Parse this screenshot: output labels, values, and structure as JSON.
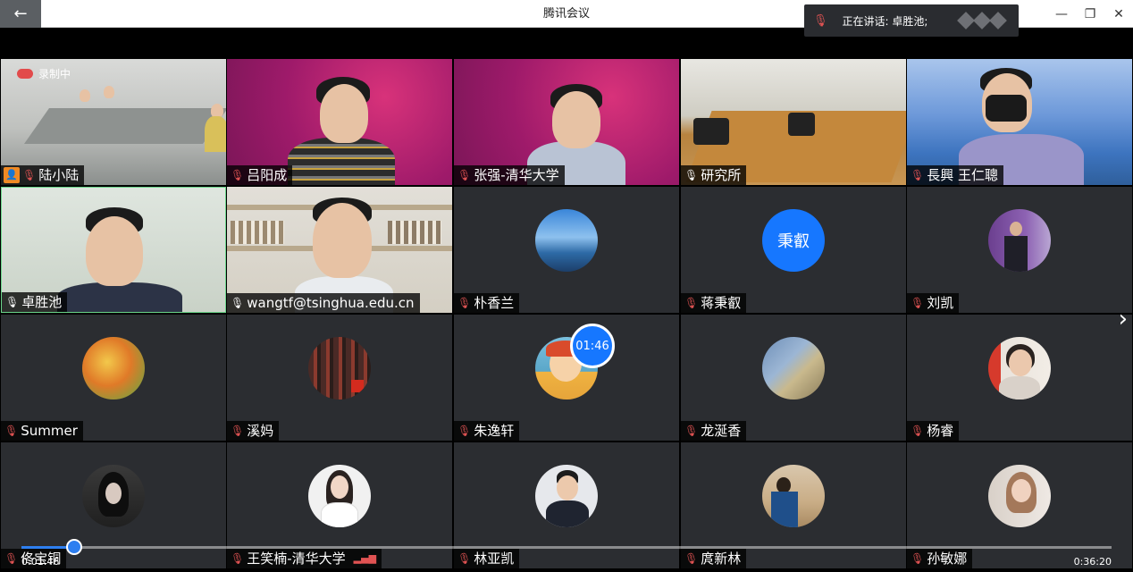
{
  "window": {
    "title": "腾讯会议",
    "back_glyph": "←",
    "minimize_glyph": "—",
    "restore_glyph": "❐",
    "close_glyph": "✕"
  },
  "speaking_banner": {
    "text": "正在讲话: 卓胜池;",
    "icon": "mic-muted-icon"
  },
  "recording": {
    "label": "录制中"
  },
  "participants": [
    {
      "name": "陆小陆",
      "mic": "muted",
      "scene": "meeting-room",
      "host": true
    },
    {
      "name": "吕阳成",
      "mic": "muted",
      "scene": "magenta"
    },
    {
      "name": "张强-清华大学",
      "mic": "muted",
      "scene": "magenta"
    },
    {
      "name": "研究所",
      "mic": "on",
      "scene": "office"
    },
    {
      "name": "長興 王仁聰",
      "mic": "muted",
      "scene": "blue-sky"
    },
    {
      "name": "卓胜池",
      "mic": "on",
      "scene": "green-wall"
    },
    {
      "name": "wangtf@tsinghua.edu.cn",
      "mic": "on",
      "scene": "shelves"
    },
    {
      "name": "朴香兰",
      "mic": "muted",
      "avatar": "sea"
    },
    {
      "name": "蒋秉叡",
      "mic": "muted",
      "avatar_text": "秉叡"
    },
    {
      "name": "刘凯",
      "mic": "muted",
      "avatar": "speaker"
    },
    {
      "name": "Summer",
      "mic": "muted",
      "avatar": "autumn"
    },
    {
      "name": "溪妈",
      "mic": "muted",
      "avatar": "books"
    },
    {
      "name": "朱逸轩",
      "mic": "muted",
      "avatar": "cartoon"
    },
    {
      "name": "龙涎香",
      "mic": "muted",
      "avatar": "sky"
    },
    {
      "name": "杨睿",
      "mic": "muted",
      "avatar": "woman-flag"
    },
    {
      "name": "佟宝铜",
      "mic": "muted",
      "avatar": "girl-headphones"
    },
    {
      "name": "王笑楠-清华大学",
      "mic": "muted",
      "avatar": "woman-white"
    },
    {
      "name": "林亚凯",
      "mic": "muted",
      "avatar": "man-suit"
    },
    {
      "name": "庹新林",
      "mic": "muted",
      "avatar": "man-desert"
    },
    {
      "name": "孙敏娜",
      "mic": "muted",
      "avatar": "woman-light"
    }
  ],
  "timer_badge": "01:46",
  "player": {
    "elapsed": "0:01:46",
    "total": "0:36:20",
    "progress": 0.0487
  },
  "colors": {
    "accent": "#2e7ff0",
    "muted_mic": "#e05353",
    "tile_bg": "#2b2d31"
  },
  "next_page_glyph": "›"
}
